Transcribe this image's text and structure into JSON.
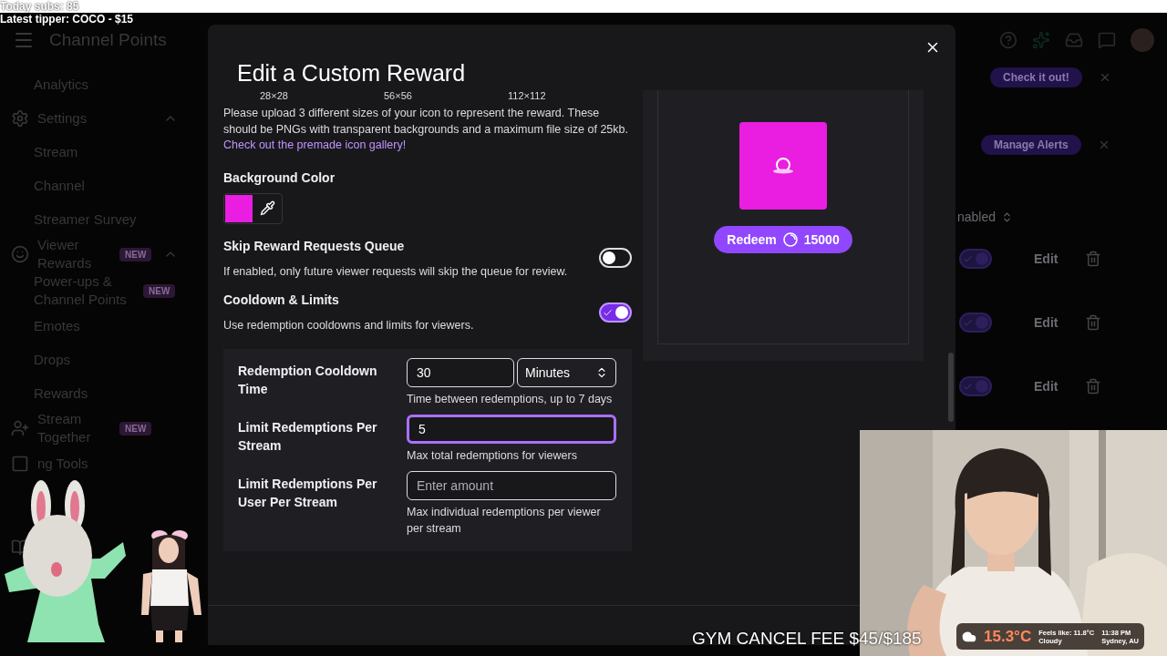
{
  "stream_overlay": {
    "stats": [
      "Today subs: 85",
      "Latest tipper: COCO - $15"
    ],
    "banner": "GYM CANCEL FEE $45/$185",
    "weather": {
      "temperature": "15.3°C",
      "feels_like": "Feels like: 11.8°C",
      "condition": "Cloudy",
      "time": "11:38 PM",
      "location": "Sydney, AU"
    }
  },
  "dashboard": {
    "title": "Channel Points",
    "sidebar": [
      {
        "kind": "sub",
        "label": "Analytics"
      },
      {
        "kind": "section",
        "label": "Settings",
        "expanded": true
      },
      {
        "kind": "sub",
        "label": "Stream"
      },
      {
        "kind": "sub",
        "label": "Channel"
      },
      {
        "kind": "sub",
        "label": "Streamer Survey"
      },
      {
        "kind": "section",
        "label": "Viewer Rewards",
        "badge": "NEW",
        "expanded": true
      },
      {
        "kind": "sub",
        "label": "Power-ups & Channel Points",
        "badge": "NEW"
      },
      {
        "kind": "sub",
        "label": "Emotes"
      },
      {
        "kind": "sub",
        "label": "Drops"
      },
      {
        "kind": "sub",
        "label": "Rewards"
      },
      {
        "kind": "link",
        "label": "Stream Together",
        "badge": "NEW"
      },
      {
        "kind": "link",
        "label": "ng Tools"
      }
    ],
    "promos": [
      {
        "button": "Check it out!"
      },
      {
        "button": "Manage Alerts"
      }
    ],
    "sort_label": "nabled",
    "reward_rows": [
      {
        "enabled": true,
        "action": "Edit"
      },
      {
        "enabled": true,
        "action": "Edit"
      },
      {
        "enabled": true,
        "action": "Edit"
      }
    ]
  },
  "modal": {
    "title": "Edit a Custom Reward",
    "icon_sizes": [
      "28×28",
      "56×56",
      "112×112"
    ],
    "upload_note": "Please upload 3 different sizes of your icon to represent the reward. These should be PNGs with transparent backgrounds and a maximum file size of 25kb.",
    "gallery_link": "Check out the premade icon gallery!",
    "background_color": {
      "label": "Background Color",
      "color": "#e91ee0"
    },
    "skip_queue": {
      "label": "Skip Reward Requests Queue",
      "description": "If enabled, only future viewer requests will skip the queue for review.",
      "on": false
    },
    "cooldown_limits": {
      "label": "Cooldown & Limits",
      "description": "Use redemption cooldowns and limits for viewers.",
      "on": true
    },
    "limits": [
      {
        "label": "Redemption Cooldown Time",
        "value": "30",
        "unit": "Minutes",
        "hint": "Time between redemptions, up to 7 days",
        "focused": false
      },
      {
        "label": "Limit Redemptions Per Stream",
        "value": "5",
        "hint": "Max total redemptions for viewers",
        "focused": true
      },
      {
        "label": "Limit Redemptions Per User Per Stream",
        "placeholder": "Enter amount",
        "hint": "Max individual redemptions per viewer per stream",
        "focused": false
      }
    ],
    "preview": {
      "button": "Redeem",
      "cost": "15000"
    }
  }
}
